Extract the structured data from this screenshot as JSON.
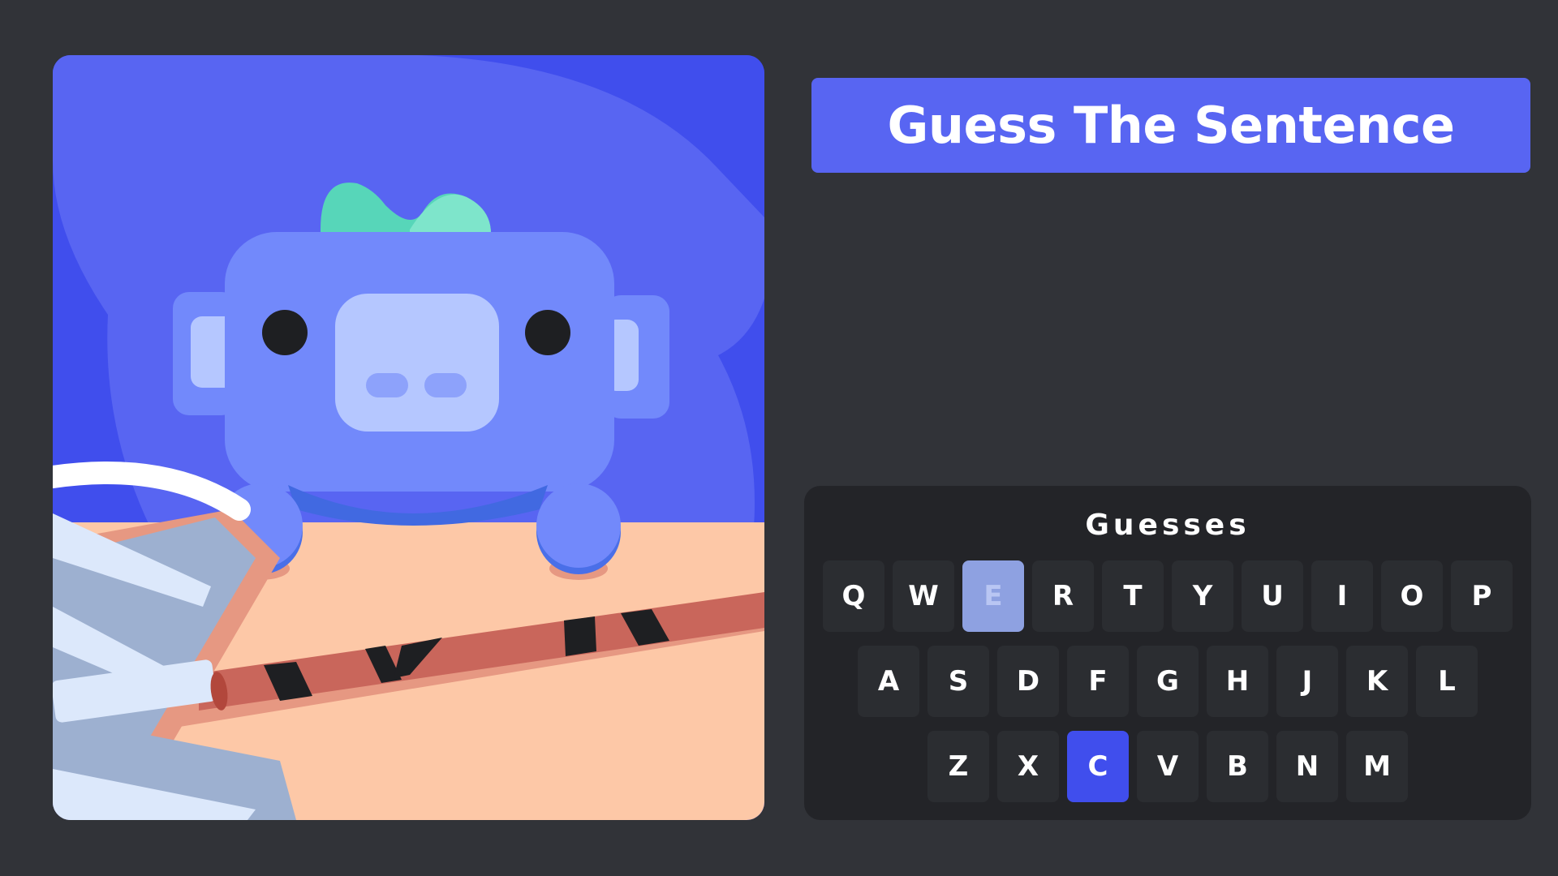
{
  "title": "Guess The Sentence",
  "colors": {
    "background": "#313338",
    "banner": "#5865f2",
    "panel": "#232428",
    "key": "#2b2d31",
    "key_missed": "#8ea1e1",
    "key_correct": "#404eed"
  },
  "keyboard": {
    "heading": "Guesses",
    "rows": [
      [
        {
          "letter": "Q",
          "state": "unused"
        },
        {
          "letter": "W",
          "state": "unused"
        },
        {
          "letter": "E",
          "state": "missed"
        },
        {
          "letter": "R",
          "state": "unused"
        },
        {
          "letter": "T",
          "state": "unused"
        },
        {
          "letter": "Y",
          "state": "unused"
        },
        {
          "letter": "U",
          "state": "unused"
        },
        {
          "letter": "I",
          "state": "unused"
        },
        {
          "letter": "O",
          "state": "unused"
        },
        {
          "letter": "P",
          "state": "unused"
        }
      ],
      [
        {
          "letter": "A",
          "state": "unused"
        },
        {
          "letter": "S",
          "state": "unused"
        },
        {
          "letter": "D",
          "state": "unused"
        },
        {
          "letter": "F",
          "state": "unused"
        },
        {
          "letter": "G",
          "state": "unused"
        },
        {
          "letter": "H",
          "state": "unused"
        },
        {
          "letter": "J",
          "state": "unused"
        },
        {
          "letter": "K",
          "state": "unused"
        },
        {
          "letter": "L",
          "state": "unused"
        }
      ],
      [
        {
          "letter": "Z",
          "state": "unused"
        },
        {
          "letter": "X",
          "state": "unused"
        },
        {
          "letter": "C",
          "state": "correct"
        },
        {
          "letter": "V",
          "state": "unused"
        },
        {
          "letter": "B",
          "state": "unused"
        },
        {
          "letter": "N",
          "state": "unused"
        },
        {
          "letter": "M",
          "state": "unused"
        }
      ]
    ]
  },
  "illustration": {
    "subject": "wumpus-mascot-illustration"
  }
}
